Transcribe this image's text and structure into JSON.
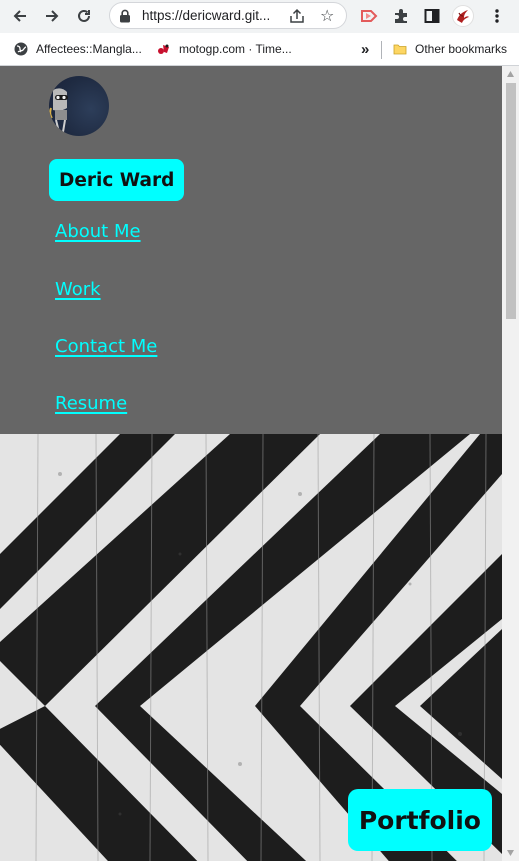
{
  "browser": {
    "url": "https://dericward.git...",
    "bookmarks": [
      {
        "label": "Affectees::Mangla..."
      },
      {
        "label": "motogp.com · Time..."
      }
    ],
    "overflow_label": "»",
    "other_bookmarks_label": "Other bookmarks"
  },
  "header": {
    "name": "Deric Ward",
    "nav": [
      {
        "label": "About Me"
      },
      {
        "label": "Work"
      },
      {
        "label": "Contact Me"
      },
      {
        "label": "Resume"
      }
    ]
  },
  "hero": {
    "button_label": "Portfolio"
  },
  "colors": {
    "accent": "#00ffff",
    "header_bg": "#666666",
    "chrome_bg": "#dee1e6",
    "text_dark": "#111111"
  }
}
